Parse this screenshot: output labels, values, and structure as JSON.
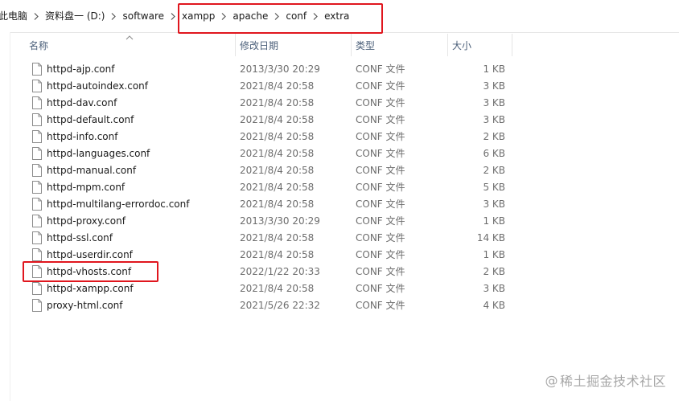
{
  "breadcrumb": {
    "items": [
      {
        "label": "此电脑"
      },
      {
        "label": "资料盘一 (D:)"
      },
      {
        "label": "software"
      },
      {
        "label": "xampp"
      },
      {
        "label": "apache"
      },
      {
        "label": "conf"
      },
      {
        "label": "extra"
      }
    ]
  },
  "columns": {
    "name": "名称",
    "date": "修改日期",
    "type": "类型",
    "size": "大小"
  },
  "files": [
    {
      "name": "httpd-ajp.conf",
      "date": "2013/3/30 20:29",
      "type": "CONF 文件",
      "size": "1 KB"
    },
    {
      "name": "httpd-autoindex.conf",
      "date": "2021/8/4 20:58",
      "type": "CONF 文件",
      "size": "3 KB"
    },
    {
      "name": "httpd-dav.conf",
      "date": "2021/8/4 20:58",
      "type": "CONF 文件",
      "size": "3 KB"
    },
    {
      "name": "httpd-default.conf",
      "date": "2021/8/4 20:58",
      "type": "CONF 文件",
      "size": "3 KB"
    },
    {
      "name": "httpd-info.conf",
      "date": "2021/8/4 20:58",
      "type": "CONF 文件",
      "size": "2 KB"
    },
    {
      "name": "httpd-languages.conf",
      "date": "2021/8/4 20:58",
      "type": "CONF 文件",
      "size": "6 KB"
    },
    {
      "name": "httpd-manual.conf",
      "date": "2021/8/4 20:58",
      "type": "CONF 文件",
      "size": "2 KB"
    },
    {
      "name": "httpd-mpm.conf",
      "date": "2021/8/4 20:58",
      "type": "CONF 文件",
      "size": "5 KB"
    },
    {
      "name": "httpd-multilang-errordoc.conf",
      "date": "2021/8/4 20:58",
      "type": "CONF 文件",
      "size": "3 KB"
    },
    {
      "name": "httpd-proxy.conf",
      "date": "2013/3/30 20:29",
      "type": "CONF 文件",
      "size": "1 KB"
    },
    {
      "name": "httpd-ssl.conf",
      "date": "2021/8/4 20:58",
      "type": "CONF 文件",
      "size": "14 KB"
    },
    {
      "name": "httpd-userdir.conf",
      "date": "2021/8/4 20:58",
      "type": "CONF 文件",
      "size": "1 KB"
    },
    {
      "name": "httpd-vhosts.conf",
      "date": "2022/1/22 20:33",
      "type": "CONF 文件",
      "size": "2 KB"
    },
    {
      "name": "httpd-xampp.conf",
      "date": "2021/8/4 20:58",
      "type": "CONF 文件",
      "size": "3 KB"
    },
    {
      "name": "proxy-html.conf",
      "date": "2021/5/26 22:32",
      "type": "CONF 文件",
      "size": "4 KB"
    }
  ],
  "watermark": {
    "symbol": "@",
    "text": "稀土掘金技术社区"
  },
  "colors": {
    "highlight": "#e0161e",
    "header_text": "#4c607a"
  }
}
